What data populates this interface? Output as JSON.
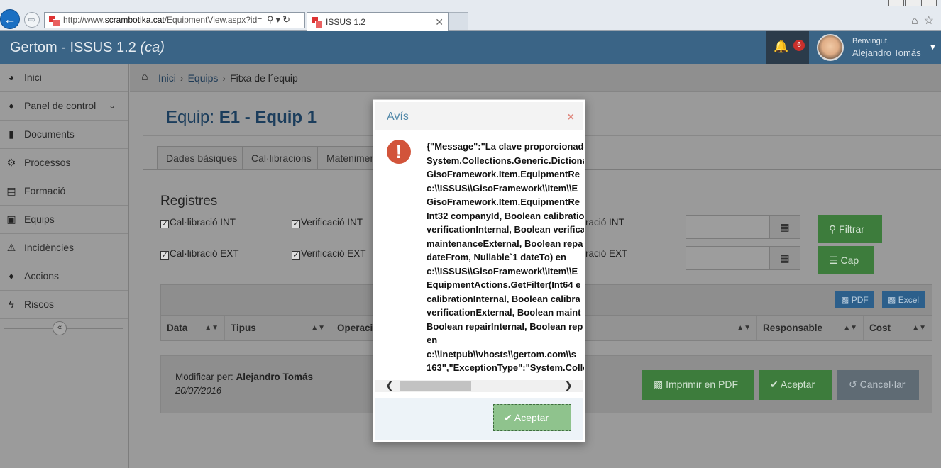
{
  "browser": {
    "url_prefix": "http://www.",
    "url_domain": "scrambotika.cat",
    "url_rest": "/EquipmentView.aspx?id=",
    "tab_title": "ISSUS 1.2",
    "tab_close": "✕"
  },
  "app": {
    "title": "Gertom - ISSUS 1.2",
    "lang": "(ca)",
    "notifications_count": "6",
    "welcome": "Benvingut,",
    "user_name": "Alejandro Tomás"
  },
  "sidebar": {
    "items": [
      {
        "label": "Inici",
        "icon": "dashboard-icon"
      },
      {
        "label": "Panel de control",
        "icon": "tag-icon"
      },
      {
        "label": "Documents",
        "icon": "file-icon"
      },
      {
        "label": "Processos",
        "icon": "cogs-icon"
      },
      {
        "label": "Formació",
        "icon": "book-icon"
      },
      {
        "label": "Equips",
        "icon": "laptop-icon"
      },
      {
        "label": "Incidències",
        "icon": "warning-icon"
      },
      {
        "label": "Accions",
        "icon": "tags-icon"
      },
      {
        "label": "Riscos",
        "icon": "bolt-icon"
      }
    ],
    "collapse_symbol": "«"
  },
  "breadcrumb": {
    "home": "Inici",
    "section": "Equips",
    "current": "Fitxa de l´equip"
  },
  "page": {
    "title_prefix": "Equip:",
    "title_name": "E1 - Equip 1"
  },
  "tabs": [
    "Dades bàsiques",
    "Cal·libracions",
    "Mateniments"
  ],
  "registres": {
    "title": "Registres",
    "checks": [
      {
        "label": "Cal·libració INT",
        "checked": true
      },
      {
        "label": "Verificació INT",
        "checked": true
      },
      {
        "label": "Cal·libració EXT",
        "checked": true
      },
      {
        "label": "Verificació EXT",
        "checked": true
      }
    ],
    "partial_labels": [
      "ració INT",
      "ració EXT"
    ],
    "filter_button": "Filtrar",
    "none_button": "Cap"
  },
  "table": {
    "pdf_button": "PDF",
    "excel_button": "Excel",
    "columns": [
      "Data",
      "Tipus",
      "Operaci",
      "",
      "Responsable",
      "Cost"
    ]
  },
  "footer": {
    "modified_by_label": "Modificar per:",
    "modified_by": "Alejandro Tomás",
    "date": "20/07/2016",
    "print_button": "Imprimir en PDF",
    "accept_button": "Aceptar",
    "cancel_button": "Cancel·lar"
  },
  "modal": {
    "title": "Avís",
    "close": "×",
    "lines": [
      "{\"Message\":\"La clave proporcionada",
      "System.Collections.Generic.Dictiona",
      "GisoFramework.Item.EquipmentRe",
      "c:\\\\ISSUS\\\\GisoFramework\\\\Item\\\\E",
      "GisoFramework.Item.EquipmentRe",
      "Int32 companyId, Boolean calibratio",
      "verificationInternal, Boolean verifica",
      "maintenanceExternal, Boolean repa",
      "dateFrom, Nullable`1 dateTo) en",
      "c:\\\\ISSUS\\\\GisoFramework\\\\Item\\\\E",
      "EquipmentActions.GetFilter(Int64 e",
      "calibrationInternal, Boolean calibra",
      "verificationExternal, Boolean maint",
      "Boolean repairInternal, Boolean rep",
      "en",
      "c:\\\\inetpub\\\\vhosts\\\\gertom.com\\\\s",
      "163\",\"ExceptionType\":\"System.Colle"
    ],
    "ok_button": "Aceptar"
  }
}
